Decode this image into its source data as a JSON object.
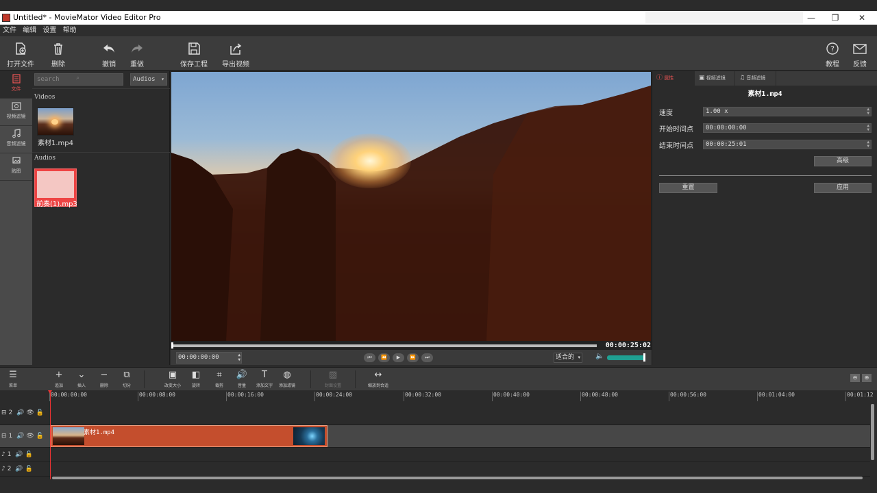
{
  "window": {
    "title": "Untitled* - MovieMator Video Editor Pro",
    "minimize": "—",
    "maximize": "❐",
    "close": "✕"
  },
  "menu": [
    "文件",
    "编辑",
    "设置",
    "帮助"
  ],
  "toolbar": {
    "open_file": "打开文件",
    "delete": "删除",
    "undo": "撤销",
    "redo": "重做",
    "save_project": "保存工程",
    "export_video": "导出视频",
    "tutorial": "教程",
    "feedback": "反馈"
  },
  "sidetabs": [
    "文件",
    "视频滤镜",
    "音频滤镜",
    "贴图"
  ],
  "library": {
    "search_placeholder": "search",
    "filter_value": "Audios",
    "videos_label": "Videos",
    "audios_label": "Audios",
    "video_items": [
      "素材1.mp4"
    ],
    "audio_items": [
      "前奏(1).mp3"
    ]
  },
  "preview": {
    "duration": "00:00:25:02",
    "timecode": "00:00:00:00",
    "zoom": "适合的",
    "progress": 0.0,
    "volume": 0.95
  },
  "properties": {
    "tabs": [
      "属性",
      "视频滤镜",
      "音频滤镜"
    ],
    "filename": "素材1.mp4",
    "speed_label": "速度",
    "speed_value": "1.00 x",
    "start_label": "开始时间点",
    "start_value": "00:00:00:00",
    "end_label": "结束时间点",
    "end_value": "00:00:25:01",
    "advanced": "高级",
    "reset": "重置",
    "apply": "应用"
  },
  "timeline_toolbar": {
    "menu": "菜单",
    "add": "追加",
    "insert": "插入",
    "remove": "删除",
    "split": "切分",
    "resize": "改变大小",
    "rotate": "旋转",
    "crop": "裁剪",
    "volume": "音量",
    "add_text": "添加文字",
    "add_filter": "添加滤镜",
    "cover": "封面设置",
    "fit_to_track": "缩放到合适"
  },
  "ruler_ticks": [
    "00:00:00:00",
    "00:00:08:00",
    "00:00:16:00",
    "00:00:24:00",
    "00:00:32:00",
    "00:00:40:00",
    "00:00:48:00",
    "00:00:56:00",
    "00:01:04:00",
    "00:01:12"
  ],
  "tracks": [
    {
      "id": "2",
      "kind": "video"
    },
    {
      "id": "1",
      "kind": "video"
    },
    {
      "id": "1",
      "kind": "audio"
    },
    {
      "id": "2",
      "kind": "audio"
    }
  ],
  "clip": {
    "label": "素材1.mp4"
  },
  "colors": {
    "accent": "#e55555",
    "clip": "#c44e2d",
    "volume": "#1fa092"
  }
}
